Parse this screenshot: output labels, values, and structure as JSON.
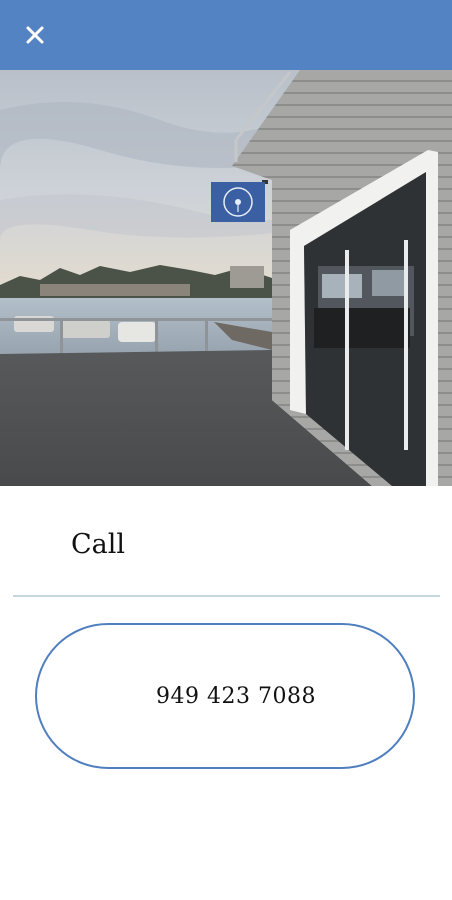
{
  "header": {
    "close_icon": "close-icon",
    "background_color": "#5483c4"
  },
  "photo": {
    "sign_icon": "circular-emblem-icon"
  },
  "contact": {
    "title": "Call",
    "phone_number": "949 423 7088",
    "accent_color": "#4f7fbf"
  }
}
